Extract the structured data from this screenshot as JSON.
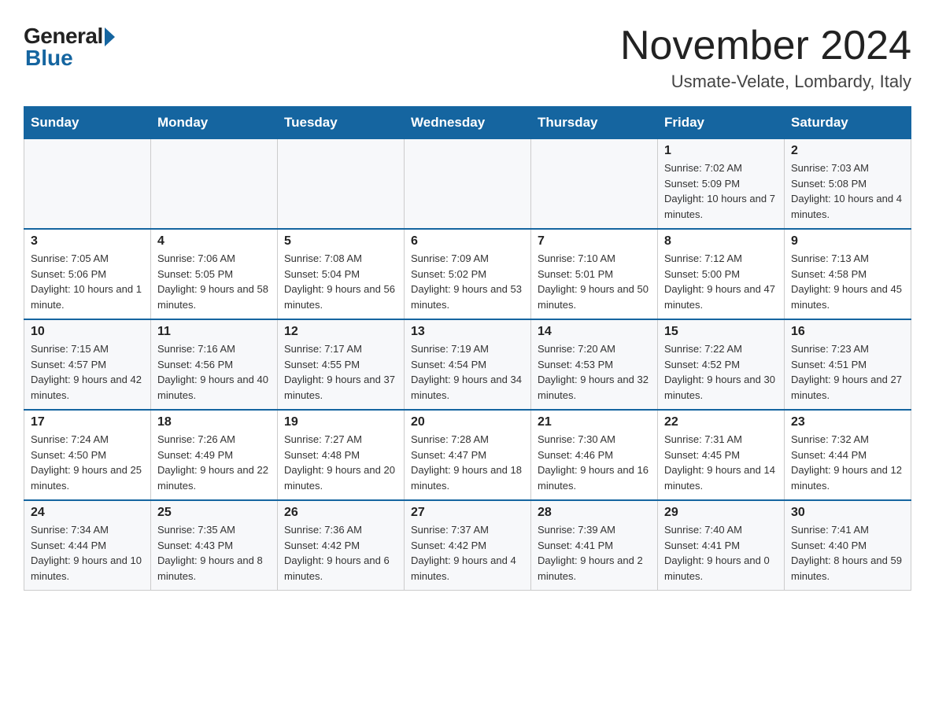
{
  "logo": {
    "general": "General",
    "blue": "Blue"
  },
  "title": "November 2024",
  "subtitle": "Usmate-Velate, Lombardy, Italy",
  "days_of_week": [
    "Sunday",
    "Monday",
    "Tuesday",
    "Wednesday",
    "Thursday",
    "Friday",
    "Saturday"
  ],
  "weeks": [
    [
      {
        "day": "",
        "info": ""
      },
      {
        "day": "",
        "info": ""
      },
      {
        "day": "",
        "info": ""
      },
      {
        "day": "",
        "info": ""
      },
      {
        "day": "",
        "info": ""
      },
      {
        "day": "1",
        "info": "Sunrise: 7:02 AM\nSunset: 5:09 PM\nDaylight: 10 hours and 7 minutes."
      },
      {
        "day": "2",
        "info": "Sunrise: 7:03 AM\nSunset: 5:08 PM\nDaylight: 10 hours and 4 minutes."
      }
    ],
    [
      {
        "day": "3",
        "info": "Sunrise: 7:05 AM\nSunset: 5:06 PM\nDaylight: 10 hours and 1 minute."
      },
      {
        "day": "4",
        "info": "Sunrise: 7:06 AM\nSunset: 5:05 PM\nDaylight: 9 hours and 58 minutes."
      },
      {
        "day": "5",
        "info": "Sunrise: 7:08 AM\nSunset: 5:04 PM\nDaylight: 9 hours and 56 minutes."
      },
      {
        "day": "6",
        "info": "Sunrise: 7:09 AM\nSunset: 5:02 PM\nDaylight: 9 hours and 53 minutes."
      },
      {
        "day": "7",
        "info": "Sunrise: 7:10 AM\nSunset: 5:01 PM\nDaylight: 9 hours and 50 minutes."
      },
      {
        "day": "8",
        "info": "Sunrise: 7:12 AM\nSunset: 5:00 PM\nDaylight: 9 hours and 47 minutes."
      },
      {
        "day": "9",
        "info": "Sunrise: 7:13 AM\nSunset: 4:58 PM\nDaylight: 9 hours and 45 minutes."
      }
    ],
    [
      {
        "day": "10",
        "info": "Sunrise: 7:15 AM\nSunset: 4:57 PM\nDaylight: 9 hours and 42 minutes."
      },
      {
        "day": "11",
        "info": "Sunrise: 7:16 AM\nSunset: 4:56 PM\nDaylight: 9 hours and 40 minutes."
      },
      {
        "day": "12",
        "info": "Sunrise: 7:17 AM\nSunset: 4:55 PM\nDaylight: 9 hours and 37 minutes."
      },
      {
        "day": "13",
        "info": "Sunrise: 7:19 AM\nSunset: 4:54 PM\nDaylight: 9 hours and 34 minutes."
      },
      {
        "day": "14",
        "info": "Sunrise: 7:20 AM\nSunset: 4:53 PM\nDaylight: 9 hours and 32 minutes."
      },
      {
        "day": "15",
        "info": "Sunrise: 7:22 AM\nSunset: 4:52 PM\nDaylight: 9 hours and 30 minutes."
      },
      {
        "day": "16",
        "info": "Sunrise: 7:23 AM\nSunset: 4:51 PM\nDaylight: 9 hours and 27 minutes."
      }
    ],
    [
      {
        "day": "17",
        "info": "Sunrise: 7:24 AM\nSunset: 4:50 PM\nDaylight: 9 hours and 25 minutes."
      },
      {
        "day": "18",
        "info": "Sunrise: 7:26 AM\nSunset: 4:49 PM\nDaylight: 9 hours and 22 minutes."
      },
      {
        "day": "19",
        "info": "Sunrise: 7:27 AM\nSunset: 4:48 PM\nDaylight: 9 hours and 20 minutes."
      },
      {
        "day": "20",
        "info": "Sunrise: 7:28 AM\nSunset: 4:47 PM\nDaylight: 9 hours and 18 minutes."
      },
      {
        "day": "21",
        "info": "Sunrise: 7:30 AM\nSunset: 4:46 PM\nDaylight: 9 hours and 16 minutes."
      },
      {
        "day": "22",
        "info": "Sunrise: 7:31 AM\nSunset: 4:45 PM\nDaylight: 9 hours and 14 minutes."
      },
      {
        "day": "23",
        "info": "Sunrise: 7:32 AM\nSunset: 4:44 PM\nDaylight: 9 hours and 12 minutes."
      }
    ],
    [
      {
        "day": "24",
        "info": "Sunrise: 7:34 AM\nSunset: 4:44 PM\nDaylight: 9 hours and 10 minutes."
      },
      {
        "day": "25",
        "info": "Sunrise: 7:35 AM\nSunset: 4:43 PM\nDaylight: 9 hours and 8 minutes."
      },
      {
        "day": "26",
        "info": "Sunrise: 7:36 AM\nSunset: 4:42 PM\nDaylight: 9 hours and 6 minutes."
      },
      {
        "day": "27",
        "info": "Sunrise: 7:37 AM\nSunset: 4:42 PM\nDaylight: 9 hours and 4 minutes."
      },
      {
        "day": "28",
        "info": "Sunrise: 7:39 AM\nSunset: 4:41 PM\nDaylight: 9 hours and 2 minutes."
      },
      {
        "day": "29",
        "info": "Sunrise: 7:40 AM\nSunset: 4:41 PM\nDaylight: 9 hours and 0 minutes."
      },
      {
        "day": "30",
        "info": "Sunrise: 7:41 AM\nSunset: 4:40 PM\nDaylight: 8 hours and 59 minutes."
      }
    ]
  ]
}
